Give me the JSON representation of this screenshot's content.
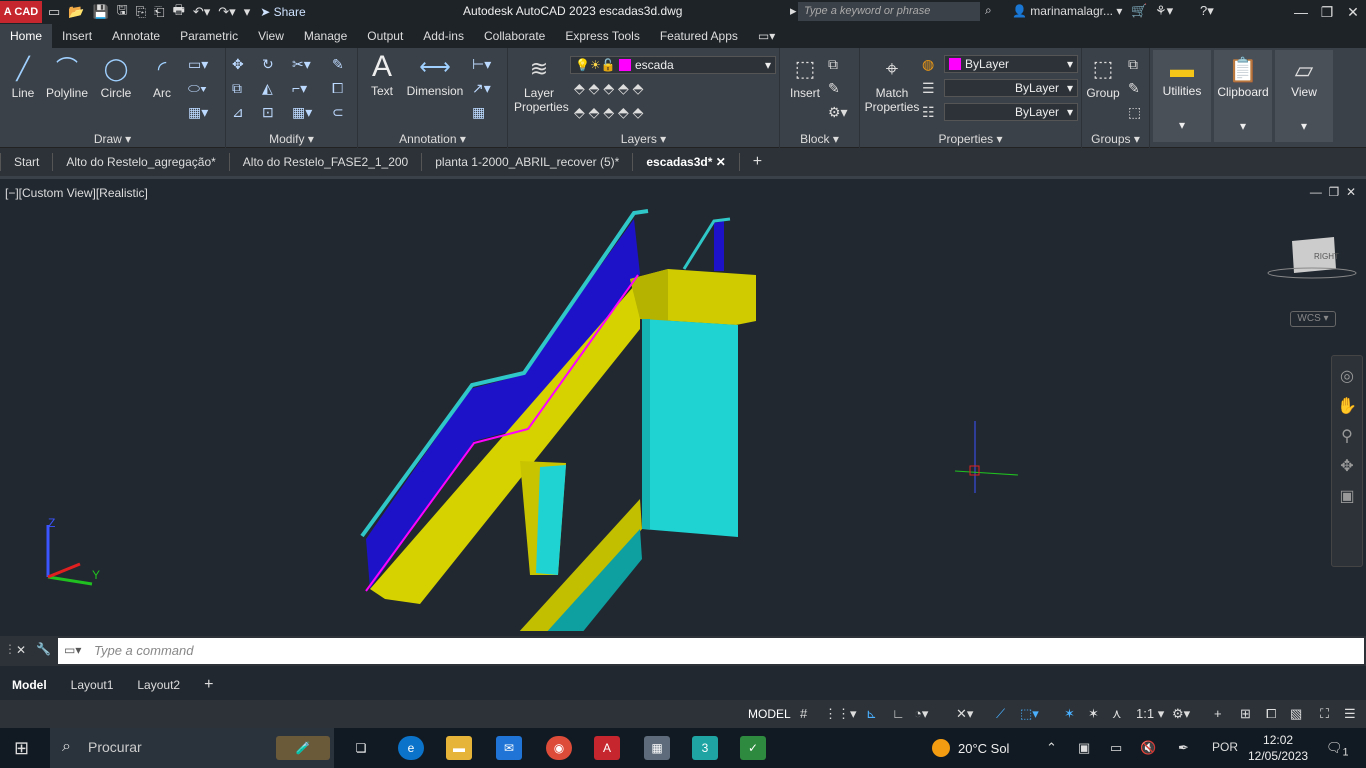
{
  "titlebar": {
    "app_badge": "A CAD",
    "share": "Share",
    "title": "Autodesk AutoCAD 2023   escadas3d.dwg",
    "search_placeholder": "Type a keyword or phrase",
    "user": "marinamalagr..."
  },
  "ribbon_tabs": [
    "Home",
    "Insert",
    "Annotate",
    "Parametric",
    "View",
    "Manage",
    "Output",
    "Add-ins",
    "Collaborate",
    "Express Tools",
    "Featured Apps"
  ],
  "ribbon": {
    "draw": {
      "label": "Draw",
      "line": "Line",
      "polyline": "Polyline",
      "circle": "Circle",
      "arc": "Arc"
    },
    "modify": {
      "label": "Modify"
    },
    "annotation": {
      "label": "Annotation",
      "text": "Text",
      "dimension": "Dimension"
    },
    "layers": {
      "label": "Layers",
      "layer_properties": "Layer Properties",
      "current_layer": "escada"
    },
    "block": {
      "label": "Block",
      "insert": "Insert"
    },
    "properties": {
      "label": "Properties",
      "match": "Match Properties",
      "color": "ByLayer",
      "linetype": "ByLayer",
      "lineweight": "ByLayer"
    },
    "groups": {
      "label": "Groups",
      "group": "Group"
    },
    "utilities": "Utilities",
    "clipboard": "Clipboard",
    "view": "View"
  },
  "doc_tabs": [
    "Start",
    "Alto do Restelo_agregação*",
    "Alto do Restelo_FASE2_1_200",
    "planta 1-2000_ABRIL_recover (5)*",
    "escadas3d*"
  ],
  "viewport": {
    "label": "[−][Custom View][Realistic]",
    "wcs": "WCS",
    "viewcube_text": "RIGHT",
    "axis_z": "Z",
    "axis_y": "Y"
  },
  "command": {
    "placeholder": "Type a command"
  },
  "layout_tabs": [
    "Model",
    "Layout1",
    "Layout2"
  ],
  "status": {
    "model": "MODEL",
    "scale": "1:1"
  },
  "taskbar": {
    "search": "Procurar",
    "weather": "20°C  Sol",
    "lang": "POR",
    "time": "12:02",
    "date": "12/05/2023",
    "notif": "1"
  }
}
